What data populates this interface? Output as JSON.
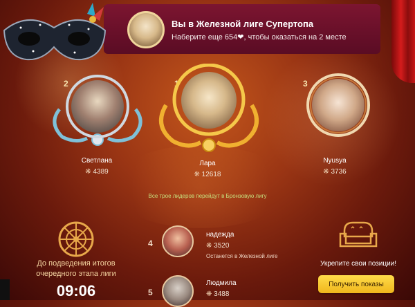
{
  "header": {
    "title": "Вы в Железной лиге Супертопа",
    "subtitle_before": "Наберите еще 654",
    "subtitle_after": ", чтобы оказаться на 2 месте",
    "heart": "❤"
  },
  "leaders": [
    {
      "rank": "2",
      "name": "Светлана",
      "score": "4389"
    },
    {
      "rank": "1",
      "name": "Лара",
      "score": "12618"
    },
    {
      "rank": "3",
      "name": "Nyusya",
      "score": "3736"
    }
  ],
  "promo_note": "Все трое лидеров перейдут в Бронзовую лигу",
  "countdown": {
    "label_line1": "До подведения итогов",
    "label_line2": "очередного этапа лиги",
    "time": "09:06"
  },
  "list": [
    {
      "rank": "4",
      "name": "надежда",
      "score": "3520",
      "status": "Останется в Железной лиге"
    },
    {
      "rank": "5",
      "name": "Людмила",
      "score": "3488",
      "status": ""
    }
  ],
  "cta": {
    "text": "Укрепите свои позиции!",
    "button": "Получить показы"
  },
  "icons": {
    "score": "gear-icon",
    "countdown": "wheel-icon",
    "cta": "sofa-icon"
  },
  "colors": {
    "button": "#f5c52a",
    "note": "#c6e07e"
  }
}
